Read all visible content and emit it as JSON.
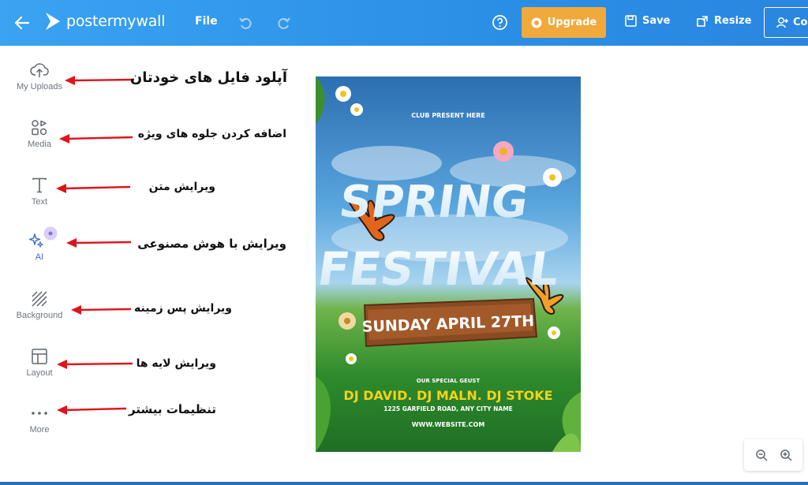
{
  "header": {
    "brand": "postermywall",
    "file_label": "File",
    "upgrade_label": "Upgrade",
    "save_label": "Save",
    "resize_label": "Resize",
    "collaborate_label": "Co"
  },
  "sidebar": {
    "items": [
      {
        "label": "My Uploads",
        "icon": "upload-cloud-icon"
      },
      {
        "label": "Media",
        "icon": "media-grid-icon"
      },
      {
        "label": "Text",
        "icon": "text-t-icon"
      },
      {
        "label": "AI",
        "icon": "sparkle-icon"
      },
      {
        "label": "Background",
        "icon": "hatched-background-icon"
      },
      {
        "label": "Layout",
        "icon": "layout-icon"
      },
      {
        "label": "More",
        "icon": "ellipsis-icon"
      }
    ]
  },
  "annotations": [
    "آپلود فایل های خودتان",
    "اضافه کردن جلوه های ویژه",
    "ویرایش متن",
    "ویرایش با هوش مصنوعی",
    "ویرایش پس زمینه",
    "ویرایش لایه ها",
    "تنظیمات بیشتر"
  ],
  "poster": {
    "club_line": "CLUB PRESENT HERE",
    "title_1": "SPRING",
    "title_2": "FESTIVAL",
    "date_banner": "SUNDAY APRIL 27TH",
    "guest_heading": "OUR SPECIAL GEUST",
    "djs": "DJ DAVID.  DJ MALN.  DJ STOKE",
    "address": "1225 GARFIELD ROAD, ANY CITY NAME",
    "website": "WWW.WEBSITE.COM"
  },
  "colors": {
    "topbar": "#2b8fe6",
    "upgrade": "#f0a93a",
    "arrow": "#e0141b",
    "dj_yellow": "#f4d21a"
  }
}
